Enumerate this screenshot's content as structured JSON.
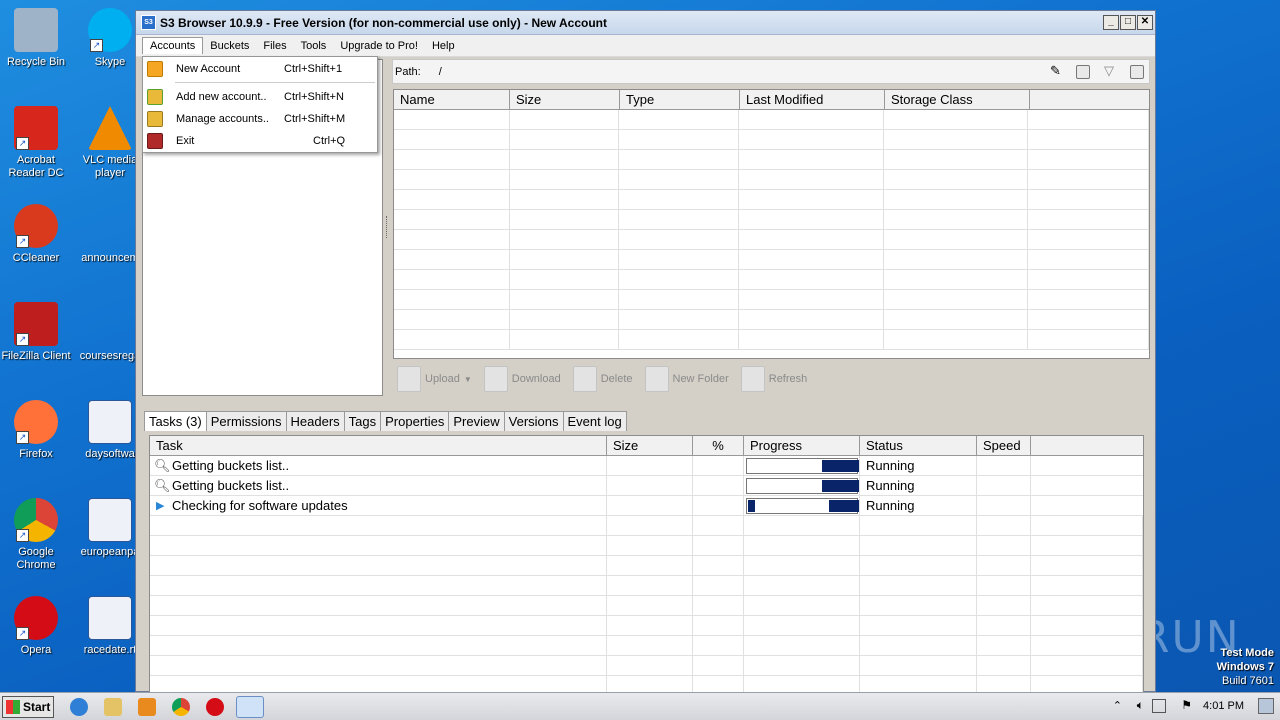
{
  "desktop": {
    "icons": [
      {
        "name": "Recycle Bin",
        "color": "#9fb3c8"
      },
      {
        "name": "Skype",
        "color": "#00aff0"
      },
      {
        "name": "Acrobat Reader DC",
        "color": "#d7261c"
      },
      {
        "name": "VLC media player",
        "color": "#f08a00"
      },
      {
        "name": "CCleaner",
        "color": "#d93a1e"
      },
      {
        "name": "announcem",
        "color": "#2a62c7"
      },
      {
        "name": "FileZilla Client",
        "color": "#bf1e1e"
      },
      {
        "name": "coursesrega",
        "color": "#2a62c7"
      },
      {
        "name": "Firefox",
        "color": "#ff7139"
      },
      {
        "name": "daysoftwa",
        "color": "#2b579a"
      },
      {
        "name": "Google Chrome",
        "color": "#4285f4"
      },
      {
        "name": "europeanpa",
        "color": "#2b579a"
      },
      {
        "name": "Opera",
        "color": "#d40c16"
      },
      {
        "name": "racedate.rt",
        "color": "#2b579a"
      }
    ]
  },
  "window": {
    "title": "S3 Browser 10.9.9 - Free Version (for non-commercial use only) - New Account",
    "app_icon": "S3"
  },
  "menu": {
    "items": [
      "Accounts",
      "Buckets",
      "Files",
      "Tools",
      "Upgrade to Pro!",
      "Help"
    ]
  },
  "dropdown": {
    "items": [
      {
        "label": "New Account",
        "shortcut": "Ctrl+Shift+1",
        "icon": "new-account-icon"
      },
      {
        "label": "Add new account..",
        "shortcut": "Ctrl+Shift+N",
        "icon": "add-account-icon"
      },
      {
        "label": "Manage accounts..",
        "shortcut": "Ctrl+Shift+M",
        "icon": "manage-accounts-icon"
      },
      {
        "label": "Exit",
        "shortcut": "Ctrl+Q",
        "icon": "exit-icon"
      }
    ]
  },
  "path": {
    "label": "Path:",
    "value": "/"
  },
  "files": {
    "columns": [
      "Name",
      "Size",
      "Type",
      "Last Modified",
      "Storage Class"
    ]
  },
  "toolbar": {
    "upload": "Upload",
    "download": "Download",
    "delete": "Delete",
    "new_folder": "New Folder",
    "refresh": "Refresh"
  },
  "tabs": [
    "Tasks (3)",
    "Permissions",
    "Headers",
    "Tags",
    "Properties",
    "Preview",
    "Versions",
    "Event log"
  ],
  "tasks": {
    "columns": [
      "Task",
      "Size",
      "%",
      "Progress",
      "Status",
      "Speed"
    ],
    "rows": [
      {
        "task": "Getting buckets list..",
        "status": "Running",
        "icon": "search-icon"
      },
      {
        "task": "Getting buckets list..",
        "status": "Running",
        "icon": "search-icon"
      },
      {
        "task": "Checking for software updates",
        "status": "Running",
        "icon": "play-icon"
      }
    ]
  },
  "taskbar": {
    "start": "Start",
    "time": "4:01 PM"
  },
  "watermark": {
    "line1": "Test Mode",
    "line2": "Windows 7",
    "line3": "Build 7601",
    "brand": "ANY.RUN"
  }
}
